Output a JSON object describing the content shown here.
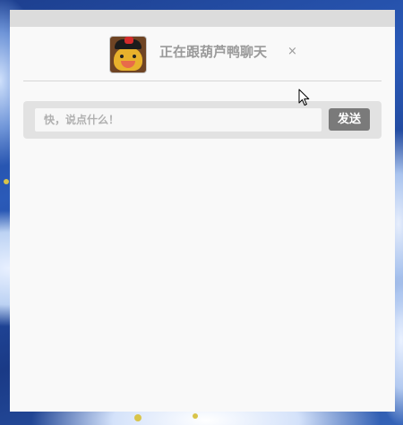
{
  "chat": {
    "title": "正在跟葫芦鸭聊天",
    "close_label": "×",
    "avatar_icon": "duck-avatar-icon"
  },
  "composer": {
    "placeholder": "快，说点什么！",
    "value": "",
    "send_label": "发送"
  },
  "colors": {
    "window_bg": "#f9f9f9",
    "titlebar": "#dcdcdc",
    "input_bar": "#e2e2e2",
    "send_button": "#7a7a7a",
    "muted_text": "#9a9a9a"
  },
  "messages": []
}
